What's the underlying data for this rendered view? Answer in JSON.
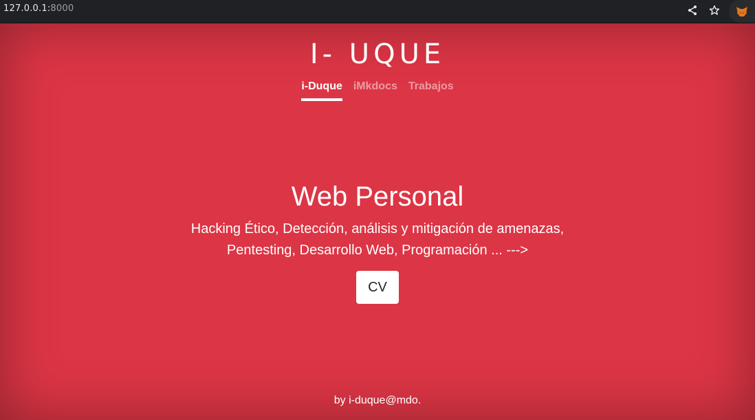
{
  "browser": {
    "url_host": "127.0.0.1:",
    "url_port": "8000",
    "icons": [
      "share-icon",
      "star-icon",
      "fox-extension-icon"
    ]
  },
  "header": {
    "brand": "I- UQUE",
    "nav": [
      {
        "label": "i-Duque",
        "active": true
      },
      {
        "label": "iMkdocs",
        "active": false
      },
      {
        "label": "Trabajos",
        "active": false
      }
    ]
  },
  "hero": {
    "title": "Web Personal",
    "line1": "Hacking Ético, Detección, análisis y mitigación de amenazas,",
    "line2": "Pentesting, Desarrollo Web, Programación ... --->",
    "button": "CV"
  },
  "footer": {
    "text": "by i-duque@mdo."
  },
  "colors": {
    "background": "#dc3545",
    "topbar": "#202124"
  }
}
